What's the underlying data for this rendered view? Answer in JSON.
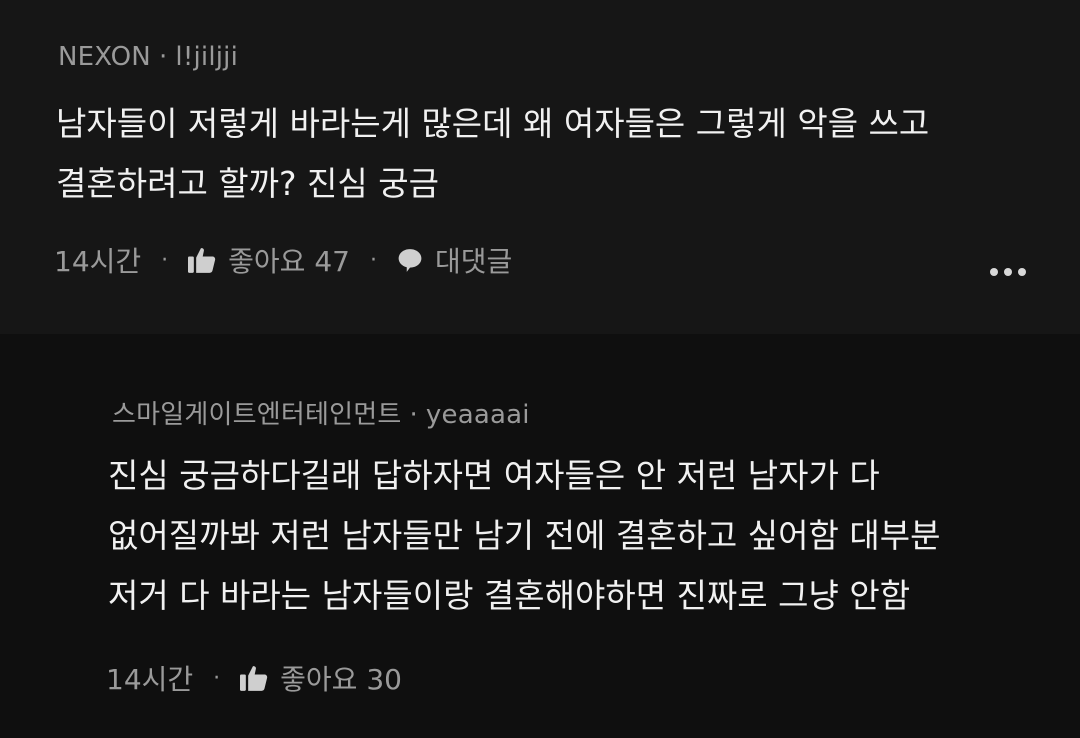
{
  "comments": [
    {
      "author": "NEXON",
      "handle": "l!jiljji",
      "text_lines": [
        "남자들이 저렇게 바라는게 많은데 왜 여자들은 그렇게 악을 쓰고",
        "결혼하려고 할까? 진심 궁금"
      ],
      "time": "14시간",
      "like_label": "좋아요",
      "like_count": "47",
      "reply_label": "대댓글"
    },
    {
      "author": "스마일게이트엔터테인먼트",
      "handle": "yeaaaai",
      "text_lines": [
        "진심 궁금하다길래 답하자면 여자들은 안 저런 남자가 다",
        "없어질까봐 저런 남자들만 남기 전에 결혼하고 싶어함 대부분",
        "저거 다 바라는 남자들이랑 결혼해야하면 진짜로 그냥 안함"
      ],
      "time": "14시간",
      "like_label": "좋아요",
      "like_count": "30"
    }
  ],
  "icons": {
    "like": "thumbs-up-icon",
    "reply": "speech-bubble-icon",
    "more": "more-horizontal-icon"
  },
  "colors": {
    "background": "#0f0f0f",
    "comment_highlight": "#161616",
    "meta_text": "#9a9a9a",
    "body_text": "#f1f1f1"
  }
}
